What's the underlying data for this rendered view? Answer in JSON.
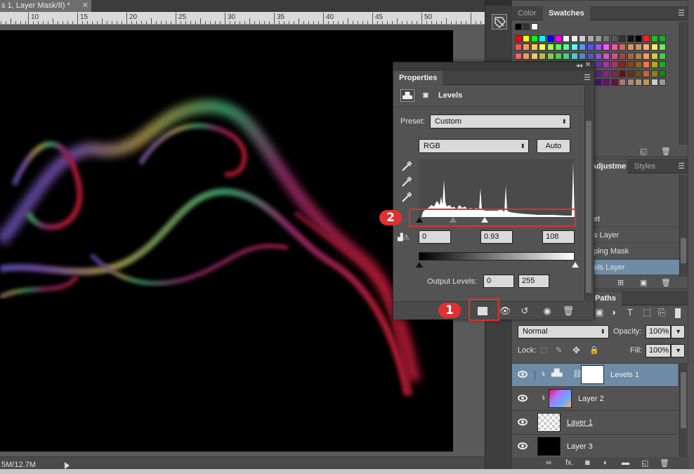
{
  "document": {
    "tab_title": "s 1, Layer Mask/8) *",
    "close_glyph": "✕",
    "ruler_labels": [
      "10",
      "15",
      "20",
      "25",
      "30",
      "35",
      "40",
      "45",
      "50"
    ],
    "status_text": "5M/12.7M"
  },
  "swatches_panel": {
    "tabs": [
      "Color",
      "Swatches"
    ],
    "active_tab": "Swatches"
  },
  "adjustments_panel": {
    "tabs": [
      "Adjustme",
      "Styles"
    ],
    "rows": [
      "et",
      "s Layer",
      "ping Mask",
      "els Layer"
    ],
    "selected_row": 3
  },
  "layers_panel": {
    "tab": "Paths",
    "blend_mode": "Normal",
    "opacity_label": "Opacity:",
    "opacity_value": "100%",
    "lock_label": "Lock:",
    "fill_label": "Fill:",
    "fill_value": "100%",
    "layers": [
      {
        "name": "Levels 1",
        "selected": true
      },
      {
        "name": "Layer 2",
        "selected": false
      },
      {
        "name": "Layer 1",
        "selected": false
      },
      {
        "name": "Layer 3",
        "selected": false
      }
    ],
    "footer_icons": [
      "link-icon",
      "fx-icon",
      "mask-icon",
      "adjustment-icon",
      "folder-icon",
      "new-layer-icon",
      "trash-icon"
    ],
    "footer_fx": "fx."
  },
  "properties_panel": {
    "tab": "Properties",
    "adjustment_name": "Levels",
    "preset_label": "Preset:",
    "preset_value": "Custom",
    "channel_value": "RGB",
    "auto_button": "Auto",
    "input_black": "0",
    "input_gamma": "0.93",
    "input_white": "108",
    "output_label": "Output Levels:",
    "output_black": "0",
    "output_white": "255",
    "footer_icons": [
      "clip-to-layer-icon",
      "view-previous-icon",
      "reset-icon",
      "visibility-icon",
      "trash-icon"
    ]
  },
  "callouts": [
    {
      "number": "1",
      "color": "#e03030"
    },
    {
      "number": "2",
      "color": "#e03030"
    }
  ],
  "colors": {
    "accent_selection": "#6e8ca6",
    "panel_bg": "#535353",
    "callout_red": "#e03030"
  }
}
